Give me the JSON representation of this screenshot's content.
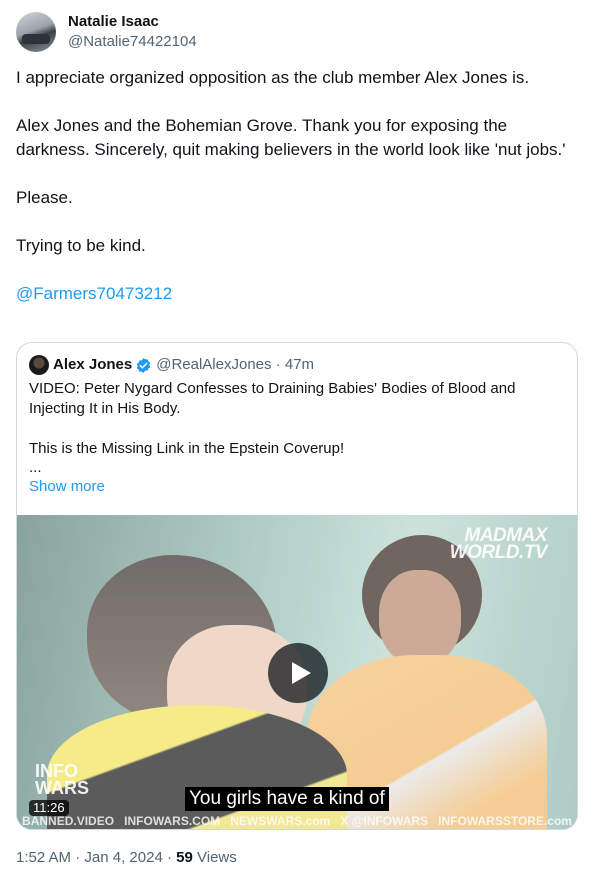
{
  "author": {
    "name": "Natalie Isaac",
    "handle": "@Natalie74422104"
  },
  "tweet": {
    "paragraphs": [
      "I appreciate organized opposition as the club member Alex Jones is.",
      "Alex Jones and the Bohemian Grove.  Thank you for exposing the darkness.  Sincerely, quit making believers in the world look like 'nut jobs.'",
      "Please.",
      "Trying to be kind."
    ],
    "mention": "@Farmers70473212"
  },
  "quote": {
    "name": "Alex Jones",
    "handle": "@RealAlexJones",
    "time": "47m",
    "text1": "VIDEO: Peter Nygard Confesses to Draining Babies' Bodies of Blood and Injecting It in His Body.",
    "text2": "This is the Missing Link in the Epstein Coverup!",
    "ellipsis": "...",
    "show_more": "Show more",
    "video": {
      "duration": "11:26",
      "caption": "You girls have a kind of",
      "logo_top_1": "MADMAX",
      "logo_top_2": "WORLD.TV",
      "logo_left_1": "INFO",
      "logo_left_2": "WARS",
      "ticker": [
        "BANNED.VIDEO",
        "INFOWARS.COM",
        "NEWSWARS.com",
        "X @INFOWARS",
        "INFOWARSSTORE.com"
      ]
    }
  },
  "footer": {
    "time": "1:52 AM",
    "sep": "·",
    "date": "Jan 4, 2024",
    "views_count": "59",
    "views_label": "Views"
  },
  "colors": {
    "accent": "#1d9bf0",
    "muted": "#536471",
    "text": "#0f1419",
    "border": "#cfd9de"
  }
}
